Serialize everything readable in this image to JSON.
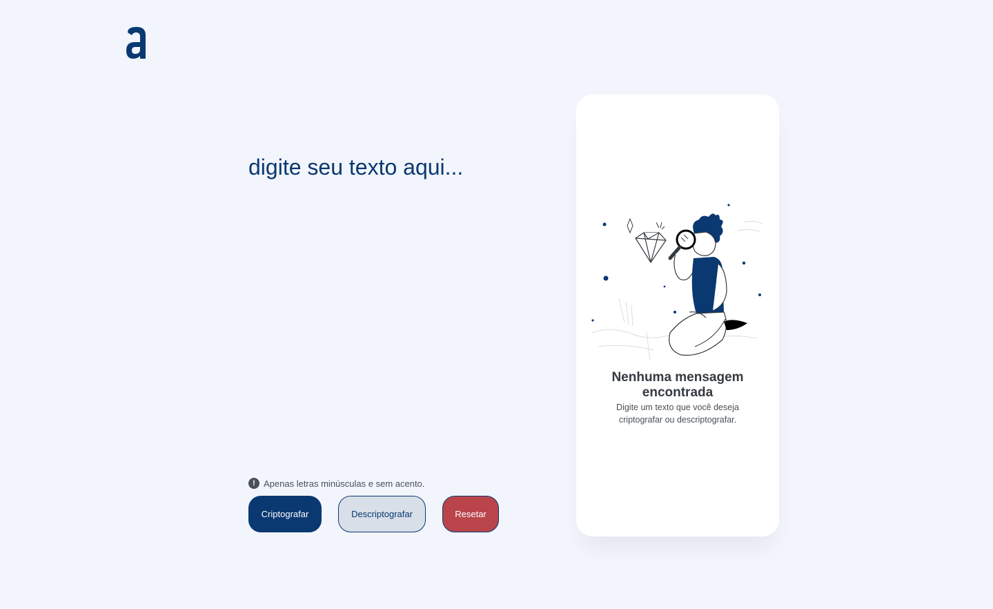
{
  "logo": {
    "letter": "a"
  },
  "input": {
    "placeholder": "digite seu texto aqui...",
    "value": ""
  },
  "warning": {
    "icon": "exclamation-icon",
    "text": "Apenas letras minúsculas e sem acento."
  },
  "buttons": {
    "encrypt": "Criptografar",
    "decrypt": "Descriptografar",
    "reset": "Resetar"
  },
  "output": {
    "title": "Nenhuma mensagem encontrada",
    "description": "Digite um texto que você deseja criptografar ou descriptografar.",
    "illustration": "person-with-magnifying-glass-diamond"
  },
  "colors": {
    "background": "#f2f5fc",
    "primary": "#0a3871",
    "secondary": "#d8dfe8",
    "danger": "#b9444a",
    "text": "#343a40"
  }
}
